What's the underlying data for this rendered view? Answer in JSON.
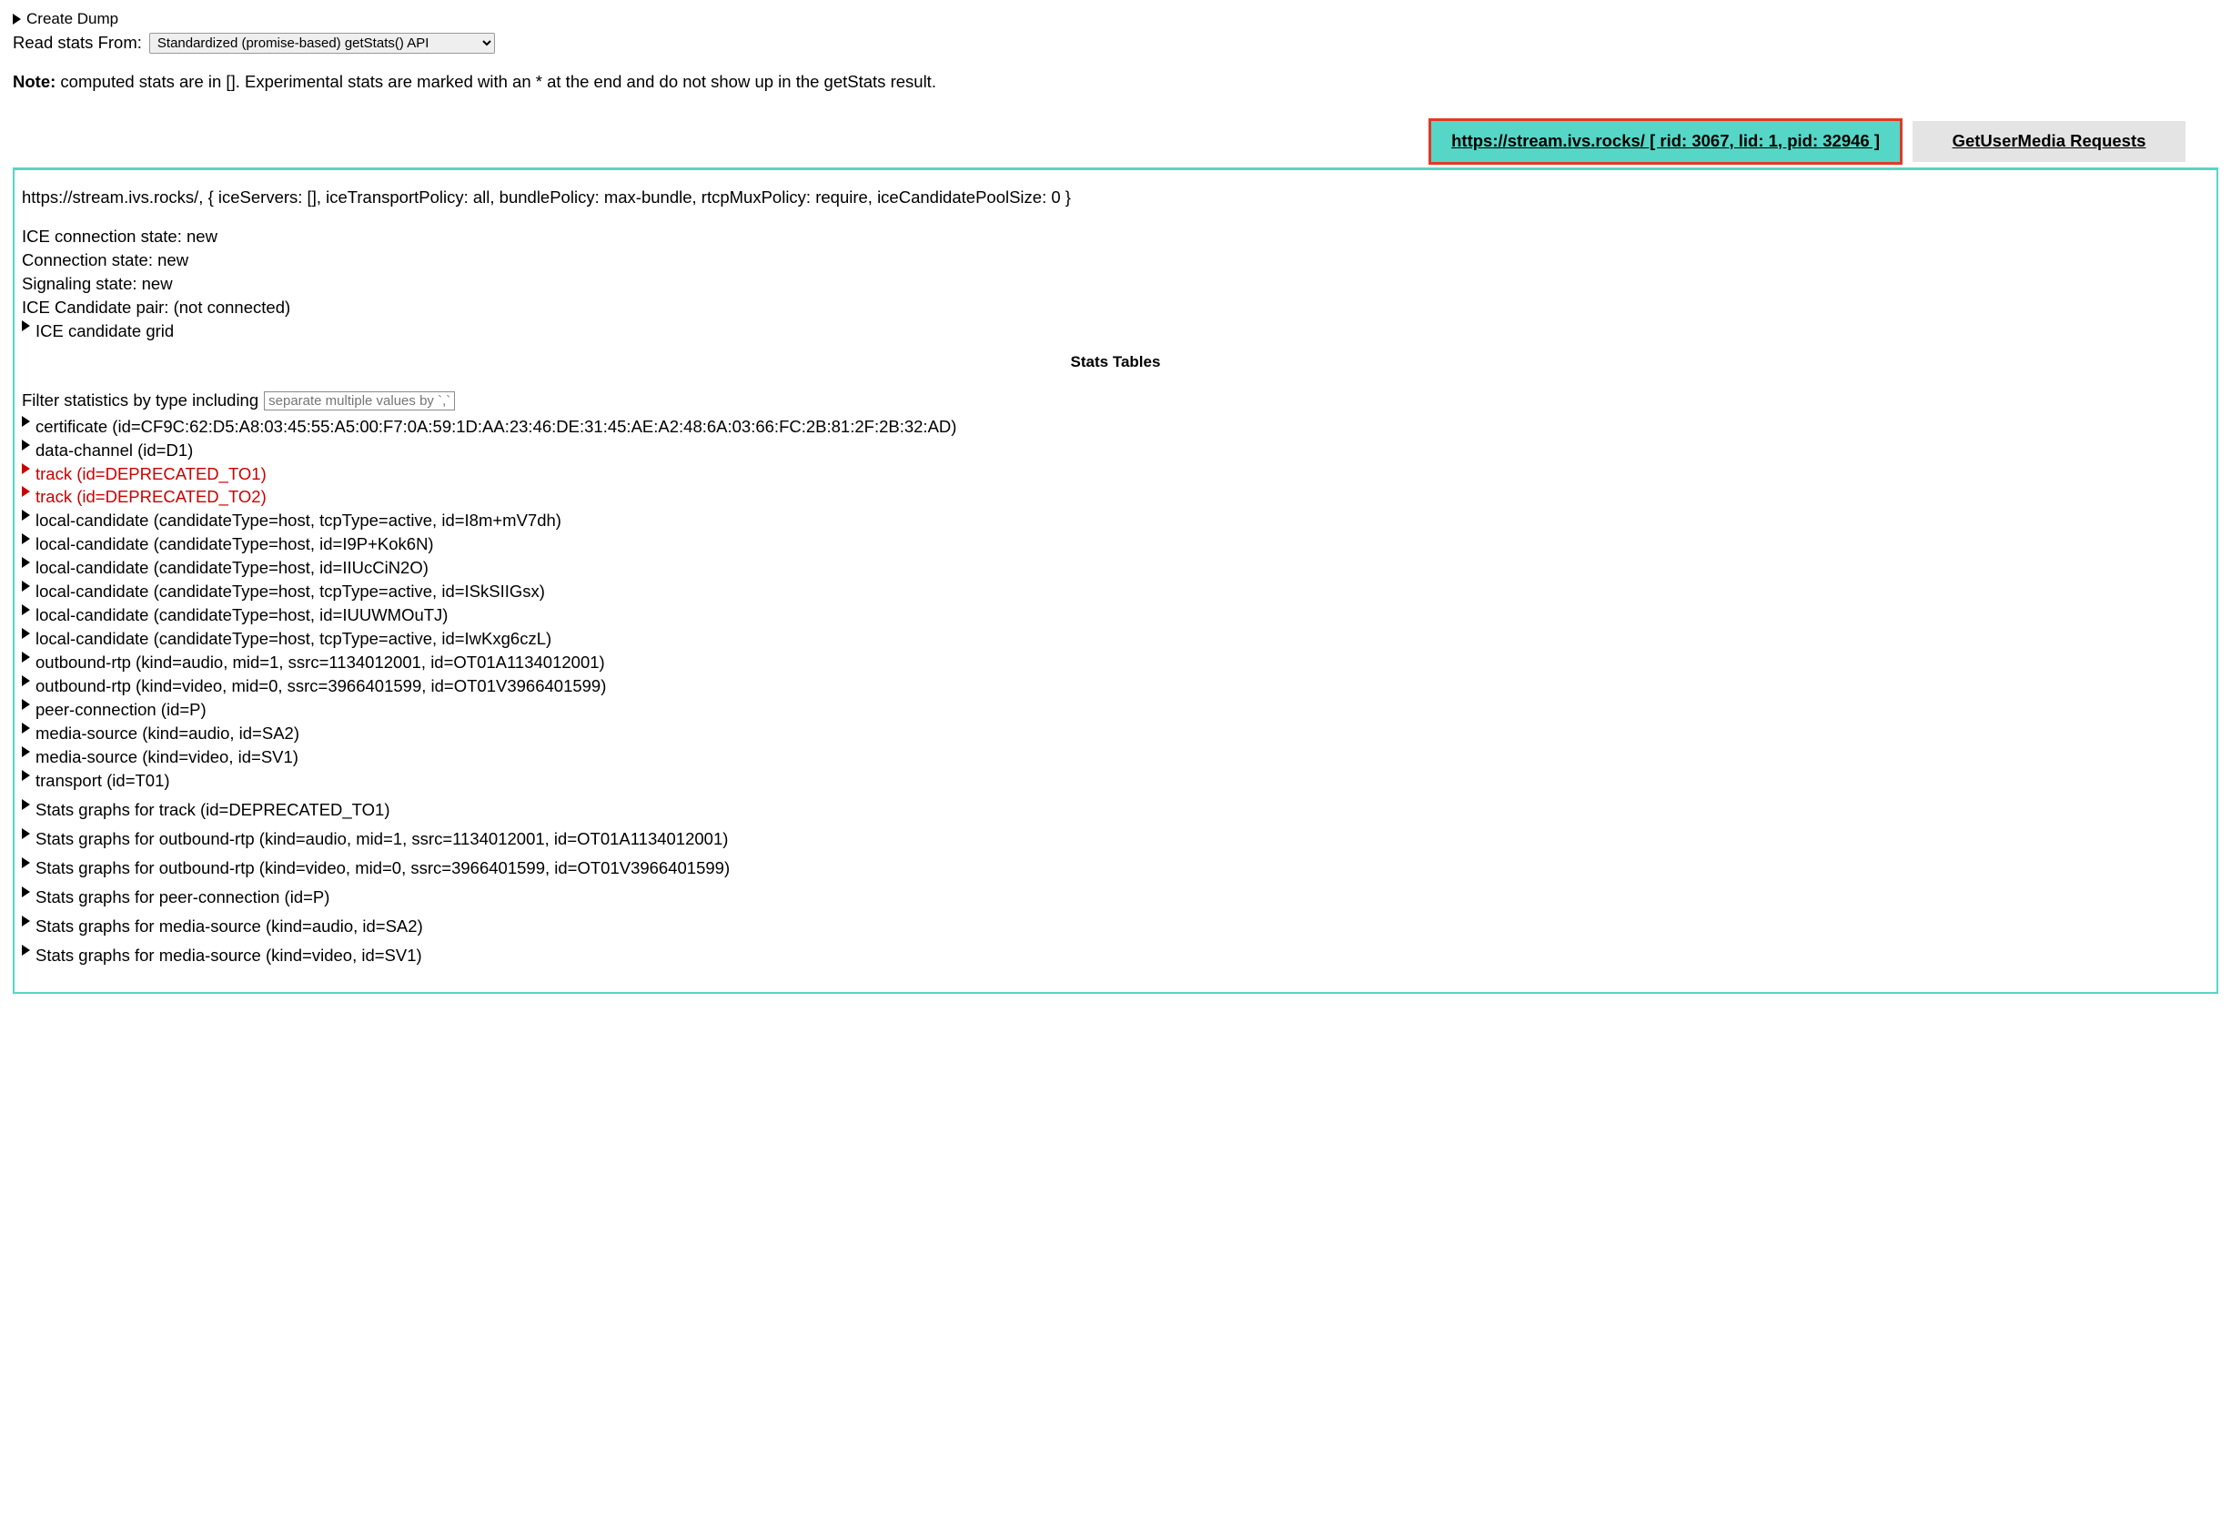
{
  "top": {
    "create_dump": "Create Dump",
    "read_label": "Read stats From:",
    "read_select_value": "Standardized (promise-based) getStats() API",
    "note_bold": "Note:",
    "note_rest": " computed stats are in []. Experimental stats are marked with an * at the end and do not show up in the getStats result."
  },
  "tabs": {
    "active": "https://stream.ivs.rocks/ [ rid: 3067, lid: 1, pid: 32946 ]",
    "inactive": "GetUserMedia Requests"
  },
  "panel": {
    "config": "https://stream.ivs.rocks/, { iceServers: [], iceTransportPolicy: all, bundlePolicy: max-bundle, rtcpMuxPolicy: require, iceCandidatePoolSize: 0 }",
    "ice_conn": "ICE connection state: new",
    "conn": "Connection state: new",
    "sig": "Signaling state: new",
    "pair": "ICE Candidate pair: (not connected)",
    "grid": "ICE candidate grid",
    "stats_tables": "Stats Tables",
    "filter_label": "Filter statistics by type including",
    "filter_placeholder": "separate multiple values by `,`"
  },
  "entries": [
    {
      "deprecated": false,
      "text": "certificate (id=CF9C:62:D5:A8:03:45:55:A5:00:F7:0A:59:1D:AA:23:46:DE:31:45:AE:A2:48:6A:03:66:FC:2B:81:2F:2B:32:AD)"
    },
    {
      "deprecated": false,
      "text": "data-channel (id=D1)"
    },
    {
      "deprecated": true,
      "text": "track (id=DEPRECATED_TO1)"
    },
    {
      "deprecated": true,
      "text": "track (id=DEPRECATED_TO2)"
    },
    {
      "deprecated": false,
      "text": "local-candidate (candidateType=host, tcpType=active, id=I8m+mV7dh)"
    },
    {
      "deprecated": false,
      "text": "local-candidate (candidateType=host, id=I9P+Kok6N)"
    },
    {
      "deprecated": false,
      "text": "local-candidate (candidateType=host, id=IIUcCiN2O)"
    },
    {
      "deprecated": false,
      "text": "local-candidate (candidateType=host, tcpType=active, id=ISkSIIGsx)"
    },
    {
      "deprecated": false,
      "text": "local-candidate (candidateType=host, id=IUUWMOuTJ)"
    },
    {
      "deprecated": false,
      "text": "local-candidate (candidateType=host, tcpType=active, id=IwKxg6czL)"
    },
    {
      "deprecated": false,
      "text": "outbound-rtp (kind=audio, mid=1, ssrc=1134012001, id=OT01A1134012001)"
    },
    {
      "deprecated": false,
      "text": "outbound-rtp (kind=video, mid=0, ssrc=3966401599, id=OT01V3966401599)"
    },
    {
      "deprecated": false,
      "text": "peer-connection (id=P)"
    },
    {
      "deprecated": false,
      "text": "media-source (kind=audio, id=SA2)"
    },
    {
      "deprecated": false,
      "text": "media-source (kind=video, id=SV1)"
    },
    {
      "deprecated": false,
      "text": "transport (id=T01)"
    },
    {
      "deprecated": false,
      "text": "Stats graphs for track (id=DEPRECATED_TO1)",
      "gap": true
    },
    {
      "deprecated": false,
      "text": "Stats graphs for outbound-rtp (kind=audio, mid=1, ssrc=1134012001, id=OT01A1134012001)",
      "gap": true
    },
    {
      "deprecated": false,
      "text": "Stats graphs for outbound-rtp (kind=video, mid=0, ssrc=3966401599, id=OT01V3966401599)",
      "gap": true
    },
    {
      "deprecated": false,
      "text": "Stats graphs for peer-connection (id=P)",
      "gap": true
    },
    {
      "deprecated": false,
      "text": "Stats graphs for media-source (kind=audio, id=SA2)",
      "gap": true
    },
    {
      "deprecated": false,
      "text": "Stats graphs for media-source (kind=video, id=SV1)",
      "gap": true
    }
  ]
}
